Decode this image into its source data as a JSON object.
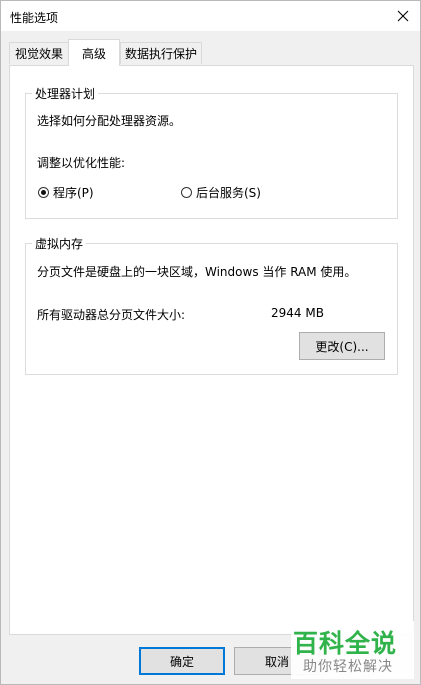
{
  "window": {
    "title": "性能选项"
  },
  "tabs": [
    {
      "label": "视觉效果",
      "active": false
    },
    {
      "label": "高级",
      "active": true
    },
    {
      "label": "数据执行保护",
      "active": false
    }
  ],
  "processor_group": {
    "legend": "处理器计划",
    "description": "选择如何分配处理器资源。",
    "adjust_label": "调整以优化性能:",
    "options": [
      {
        "label": "程序(P)",
        "selected": true
      },
      {
        "label": "后台服务(S)",
        "selected": false
      }
    ]
  },
  "memory_group": {
    "legend": "虚拟内存",
    "description": "分页文件是硬盘上的一块区域，Windows 当作 RAM 使用。",
    "total_label": "所有驱动器总分页文件大小:",
    "total_value": "2944 MB",
    "change_button": "更改(C)..."
  },
  "footer": {
    "ok_button": "确定",
    "cancel_button": "取消"
  },
  "watermark": {
    "main": "百科全说",
    "sub": "助你轻松解决"
  }
}
